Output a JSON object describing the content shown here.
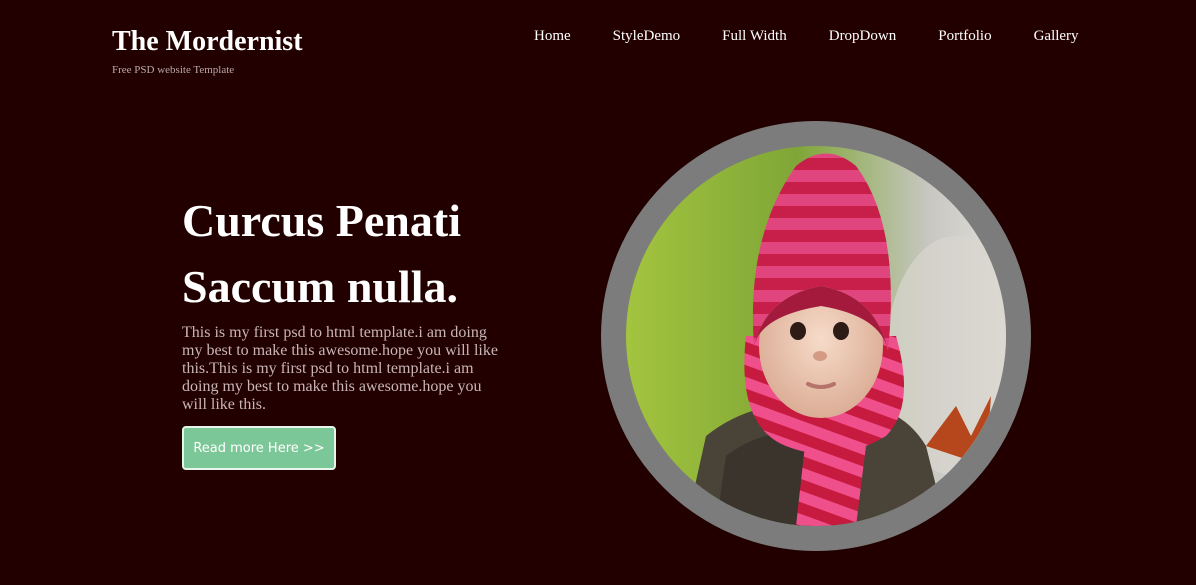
{
  "brand": {
    "title": "The Mordernist",
    "tagline": "Free PSD website Template"
  },
  "nav": {
    "items": [
      "Home",
      "StyleDemo",
      "Full Width",
      "DropDown",
      "Portfolio",
      "Gallery"
    ]
  },
  "hero": {
    "headline_line1": "Curcus Penati",
    "headline_line2": "Saccum nulla.",
    "body": "This is my first psd to html template.i am doing my best to make this awesome.hope you will like this.This is my first psd to html template.i am doing my best to make this awesome.hope you will like this.",
    "cta_label": "Read more Here >>"
  },
  "colors": {
    "background": "#220000",
    "cta": "#7cc797",
    "frame": "#7c7c7c"
  }
}
